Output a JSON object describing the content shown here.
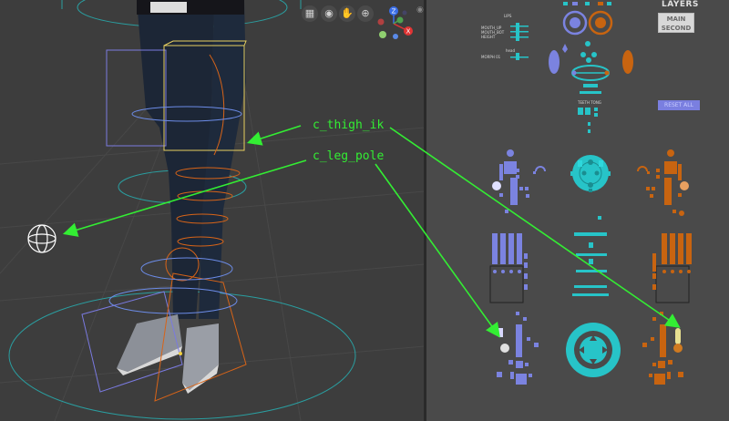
{
  "viewport": {
    "nav_buttons": [
      {
        "icon": "grid-icon",
        "glyph": "▦"
      },
      {
        "icon": "camera-icon",
        "glyph": "◉"
      },
      {
        "icon": "pan-hand-icon",
        "glyph": "✋"
      },
      {
        "icon": "zoom-icon",
        "glyph": "⊕"
      }
    ],
    "gizmo": {
      "z_label": "Z",
      "x_label": "X"
    },
    "callouts": {
      "thigh": "c_thigh_ik",
      "pole": "c_leg_pole"
    }
  },
  "picker": {
    "layers_title": "LAYERS",
    "layer_button_line1": "MAIN",
    "layer_button_line2": "SECOND",
    "reset_label": "RESET ALL",
    "lips_label": "LIPS",
    "mouth_up": "MOUTH_UP",
    "mouth_bot": "MOUTH_BOT",
    "height": "HEIGHT",
    "head_label": "head",
    "morph": "MORPH 01",
    "teeth_tong": "TEETH TONG"
  },
  "colors": {
    "callout_green": "#33ee33",
    "left_blue": "#7b83e0",
    "right_orange": "#c86410",
    "center_cyan": "#27c4c8",
    "selected_yellow": "#e8e090"
  }
}
